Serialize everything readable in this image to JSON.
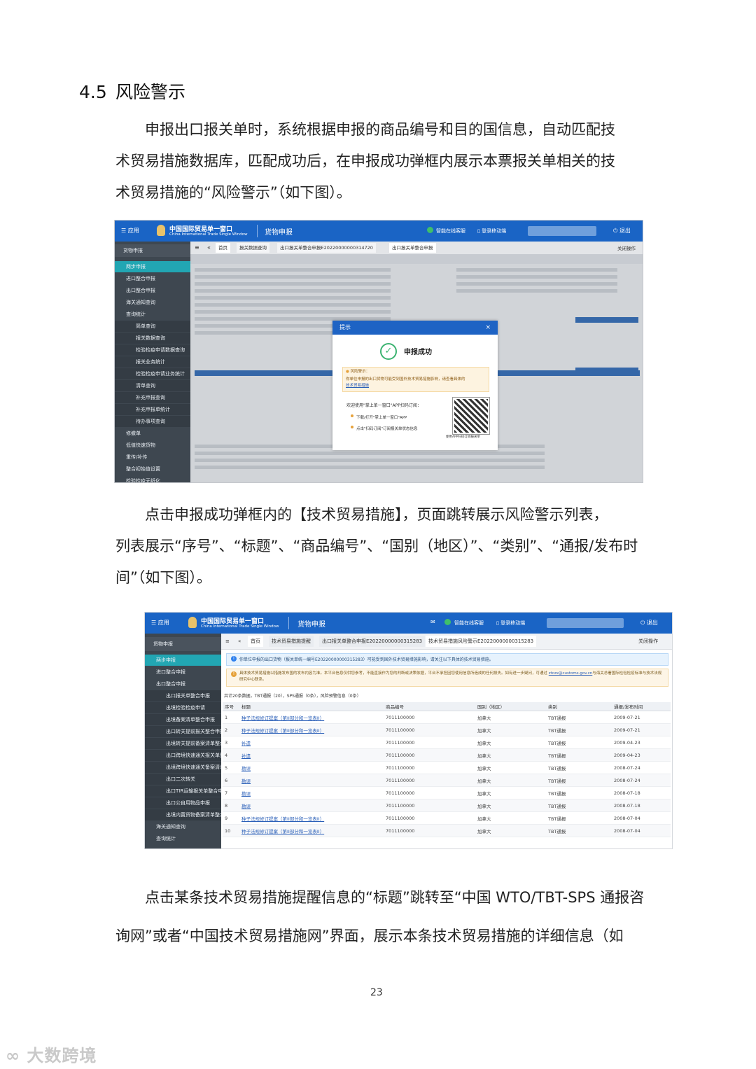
{
  "section": {
    "number": "4.5",
    "title": "风险警示"
  },
  "paragraph1": {
    "lines": [
      "申报出口报关单时，系统根据申报的商品编号和目的国信息，自动匹配技",
      "术贸易措施数据库，匹配成功后，在申报成功弹框内展示本票报关单相关的技",
      "术贸易措施的“风险警示”（如下图）。"
    ]
  },
  "screenshot1": {
    "app_title": "中国国际贸易单一窗口",
    "app_subtitle": "China International Trade Single Window",
    "module": "货物申报",
    "menu": "应用",
    "service": "智能在线客服",
    "mobile": "登录移动端",
    "logout": "退出",
    "sidebar_header": "货物申报",
    "sidebar_items": [
      "两步申报",
      "进口整合申报",
      "出口整合申报",
      "海关通知查询",
      "查询统计",
      "简单查询",
      "报关数据查询",
      "检验检疫申请数据查询",
      "报关业务统计",
      "检验检疫申请业务统计",
      "清单查询",
      "补充申报查询",
      "补充申报单统计",
      "待办事项查询",
      "修撤单",
      "低值快速货物",
      "重传/补传",
      "整合初始值设置",
      "检验检疫无纸化"
    ],
    "tabs": [
      "首页",
      "报关数据查询",
      "出口报关单整合申报E20220000000314720",
      "出口报关单整合申报"
    ],
    "tab_right": "关闭操作",
    "modal": {
      "title": "提示",
      "success": "申报成功",
      "risk_label": "风险警示：",
      "risk_text": "你单位申报的出口货物可能受到国外技术贸易措施影响，请查看具体的",
      "risk_link": "技术贸易措施",
      "welcome": "欢迎使用\"掌上单一窗口\"APP扫码订阅：",
      "step1": "下载/打开\"掌上单一窗口\"APP",
      "step2": "点击\"扫码订阅\"订阅报关单状态信息",
      "qr_caption": "使用APP扫码订阅报关单"
    }
  },
  "paragraph2": {
    "lines": [
      "点击申报成功弹框内的【技术贸易措施】，页面跳转展示风险警示列表，",
      "列表展示“序号”、“标题”、“商品编号”、“国别（地区）”、“类别”、“通报/发布时",
      "间”（如下图）。"
    ]
  },
  "screenshot2": {
    "app_title": "中国国际贸易单一窗口",
    "app_subtitle": "China International Trade Single Window",
    "module": "货物申报",
    "menu": "应用",
    "service": "智能在线客服",
    "mobile": "登录移动端",
    "logout": "退出",
    "sidebar_header": "货物申报",
    "sidebar_items": [
      "两步申报",
      "进口整合申报",
      "出口整合申报",
      "出口报关单整合申报",
      "出境检验检疫申请",
      "出境备案清单整合申报",
      "出口转关提前报关整合申报",
      "出境转关提前备案清单整合申报",
      "出口跨境快速通关报关单整合申报",
      "出境跨境快速通关备案清单整合申报",
      "出口二次转关",
      "出口TIR运输报关单整合申报",
      "出口公自用物品申报",
      "出境内置货物备案清单整合申报",
      "海关通知查询",
      "查询统计"
    ],
    "tabs": [
      "首页",
      "技术贸易措施提醒",
      "出口报关单整合申报E20220000000315283",
      "技术贸易措施风险警示E20220000000315283"
    ],
    "tab_right": "关闭操作",
    "notice_blue": "你单位申报的出口货物（报关单统一编号E20220000000315283）可能受到国外技术贸易措施影响，请关注以下具体的技术贸易措施。",
    "notice_yellow": "具体技术贸易措施以措施发布国的发布内容为准。本平台信息仅供您参考，不能直接作为您的判断或决策依据，平台不承担因您使用信息所造成的任何损失。如有进一步疑问，可通过",
    "notice_email": "ztczx@customs.gov.cn",
    "notice_yellow_tail": "与海关总署国际检验检疫标准与技术法规研究中心联系。",
    "summary": "共计20条数据，TBT通报（20），SPS通报（0条），风险预警信息（0条）",
    "columns": [
      "序号",
      "标题",
      "商品编号",
      "国别（地区）",
      "类别",
      "通报/发布时间"
    ],
    "rows": [
      [
        "1",
        "种子法规修订提案（第II部分和一览表II）",
        "7011100000",
        "加拿大",
        "TBT通报",
        "2009-07-21"
      ],
      [
        "2",
        "种子法规修订提案（第II部分和一览表II）",
        "7011100000",
        "加拿大",
        "TBT通报",
        "2009-07-21"
      ],
      [
        "3",
        "补遗",
        "7011100000",
        "加拿大",
        "TBT通报",
        "2009-04-23"
      ],
      [
        "4",
        "补遗",
        "7011100000",
        "加拿大",
        "TBT通报",
        "2009-04-23"
      ],
      [
        "5",
        "勘误",
        "7011100000",
        "加拿大",
        "TBT通报",
        "2008-07-24"
      ],
      [
        "6",
        "勘误",
        "7011100000",
        "加拿大",
        "TBT通报",
        "2008-07-24"
      ],
      [
        "7",
        "勘误",
        "7011100000",
        "加拿大",
        "TBT通报",
        "2008-07-18"
      ],
      [
        "8",
        "勘误",
        "7011100000",
        "加拿大",
        "TBT通报",
        "2008-07-18"
      ],
      [
        "9",
        "种子法规修订提案（第II部分和一览表II）",
        "7011100000",
        "加拿大",
        "TBT通报",
        "2008-07-04"
      ],
      [
        "10",
        "种子法规修订提案（第II部分和一览表II）",
        "7011100000",
        "加拿大",
        "TBT通报",
        "2008-07-04"
      ]
    ]
  },
  "paragraph3": {
    "lines": [
      "点击某条技术贸易措施提醒信息的“标题”跳转至“中国 WTO/TBT-SPS 通报咨",
      "询网”或者“中国技术贸易措施网”界面，展示本条技术贸易措施的详细信息（如"
    ]
  },
  "page_number": "23",
  "watermark": "大数跨境"
}
